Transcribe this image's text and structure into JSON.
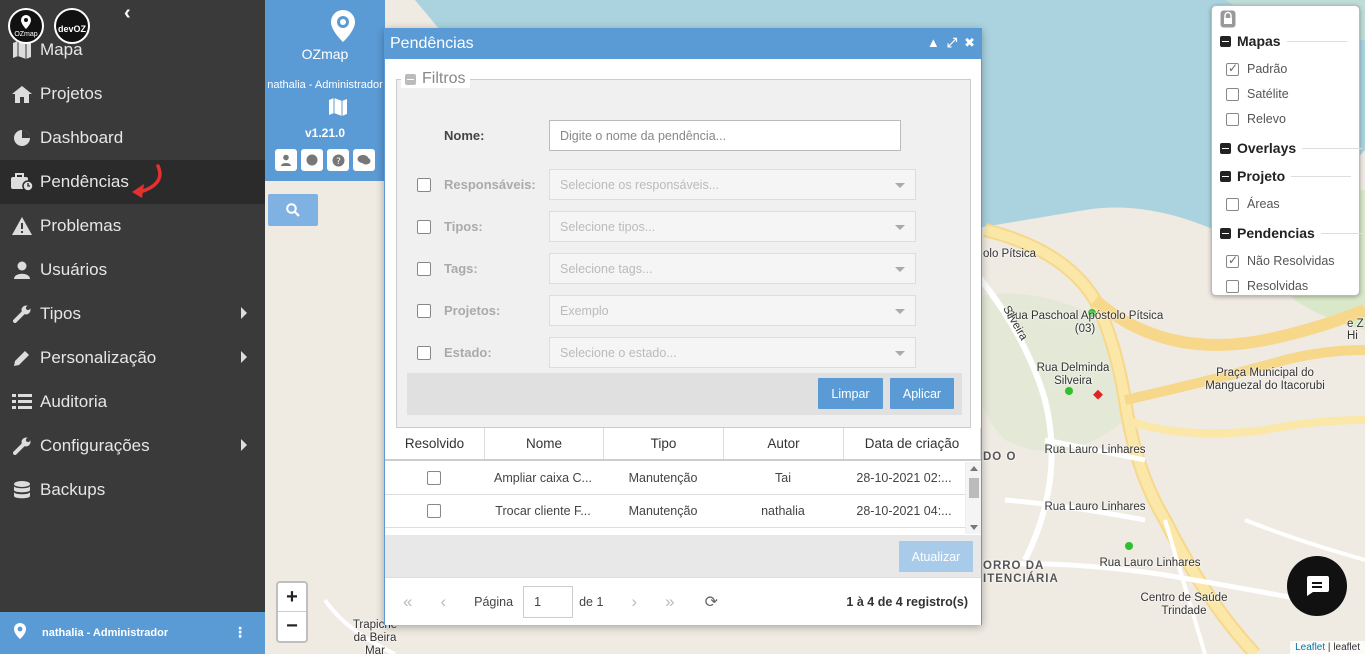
{
  "sidebar": {
    "logos": [
      "OZmap",
      "devOZ"
    ],
    "items": [
      {
        "label": "Mapa",
        "icon": "map-icon"
      },
      {
        "label": "Projetos",
        "icon": "home-icon"
      },
      {
        "label": "Dashboard",
        "icon": "pie-chart-icon"
      },
      {
        "label": "Pendências",
        "icon": "briefcase-clock-icon",
        "active": true
      },
      {
        "label": "Problemas",
        "icon": "warning-icon"
      },
      {
        "label": "Usuários",
        "icon": "user-icon"
      },
      {
        "label": "Tipos",
        "icon": "wrench-icon",
        "submenu": true
      },
      {
        "label": "Personalização",
        "icon": "pencil-icon",
        "submenu": true
      },
      {
        "label": "Auditoria",
        "icon": "list-icon"
      },
      {
        "label": "Configurações",
        "icon": "wrench-icon",
        "submenu": true
      },
      {
        "label": "Backups",
        "icon": "database-icon"
      }
    ],
    "footer_user": "nathalia - Administrador",
    "footer_logo": "OZmap"
  },
  "panel": {
    "brand": "OZmap",
    "user": "nathalia - Administrador",
    "version": "v1.21.0"
  },
  "layers": {
    "groups": [
      {
        "title": "Mapas",
        "items": [
          {
            "label": "Padrão",
            "checked": true
          },
          {
            "label": "Satélite",
            "checked": false
          },
          {
            "label": "Relevo",
            "checked": false
          }
        ]
      },
      {
        "title": "Overlays",
        "items": []
      },
      {
        "title": "Projeto",
        "items": [
          {
            "label": "Áreas",
            "checked": false
          }
        ]
      },
      {
        "title": "Pendencias",
        "items": [
          {
            "label": "Não Resolvidas",
            "checked": true
          },
          {
            "label": "Resolvidas",
            "checked": false
          }
        ]
      }
    ]
  },
  "map": {
    "labels": [
      "Rua Paschoal Apóstolo Pítsica (03)",
      "Rua Delminda Silveira",
      "Praça Municipal do Manguezal do Itacorubi",
      "Rua Lauro Linhares",
      "Rua Lauro Linhares",
      "Rua Lauro Linhares",
      "Centro de Saúde Trindade",
      "ORRO DA ITENCIÁRIA",
      "DO O",
      "Trapiche da Beira Mar",
      "Silveira",
      "olo Pítsica",
      "Hi",
      "e Z"
    ],
    "attribution_link": "Leaflet",
    "attribution_text": "leaflet",
    "zoom_in": "+",
    "zoom_out": "−"
  },
  "modal": {
    "title": "Pendências",
    "filters_legend": "Filtros",
    "name_label": "Nome:",
    "name_placeholder": "Digite o nome da pendência...",
    "filters": [
      {
        "label": "Responsáveis:",
        "placeholder": "Selecione os responsáveis..."
      },
      {
        "label": "Tipos:",
        "placeholder": "Selecione tipos..."
      },
      {
        "label": "Tags:",
        "placeholder": "Selecione tags..."
      },
      {
        "label": "Projetos:",
        "placeholder": "Exemplo"
      },
      {
        "label": "Estado:",
        "placeholder": "Selecione o estado..."
      }
    ],
    "clear_label": "Limpar",
    "apply_label": "Aplicar",
    "columns": [
      "Resolvido",
      "Nome",
      "Tipo",
      "Autor",
      "Data de criação"
    ],
    "rows": [
      {
        "nome": "Ampliar caixa C...",
        "tipo": "Manutenção",
        "autor": "Tai",
        "data": "28-10-2021 02:..."
      },
      {
        "nome": "Trocar cliente F...",
        "tipo": "Manutenção",
        "autor": "nathalia",
        "data": "28-10-2021 04:..."
      }
    ],
    "refresh_label": "Atualizar",
    "page_label": "Página",
    "page_value": "1",
    "page_of": "de 1",
    "records": "1 à 4 de 4 registro(s)"
  }
}
